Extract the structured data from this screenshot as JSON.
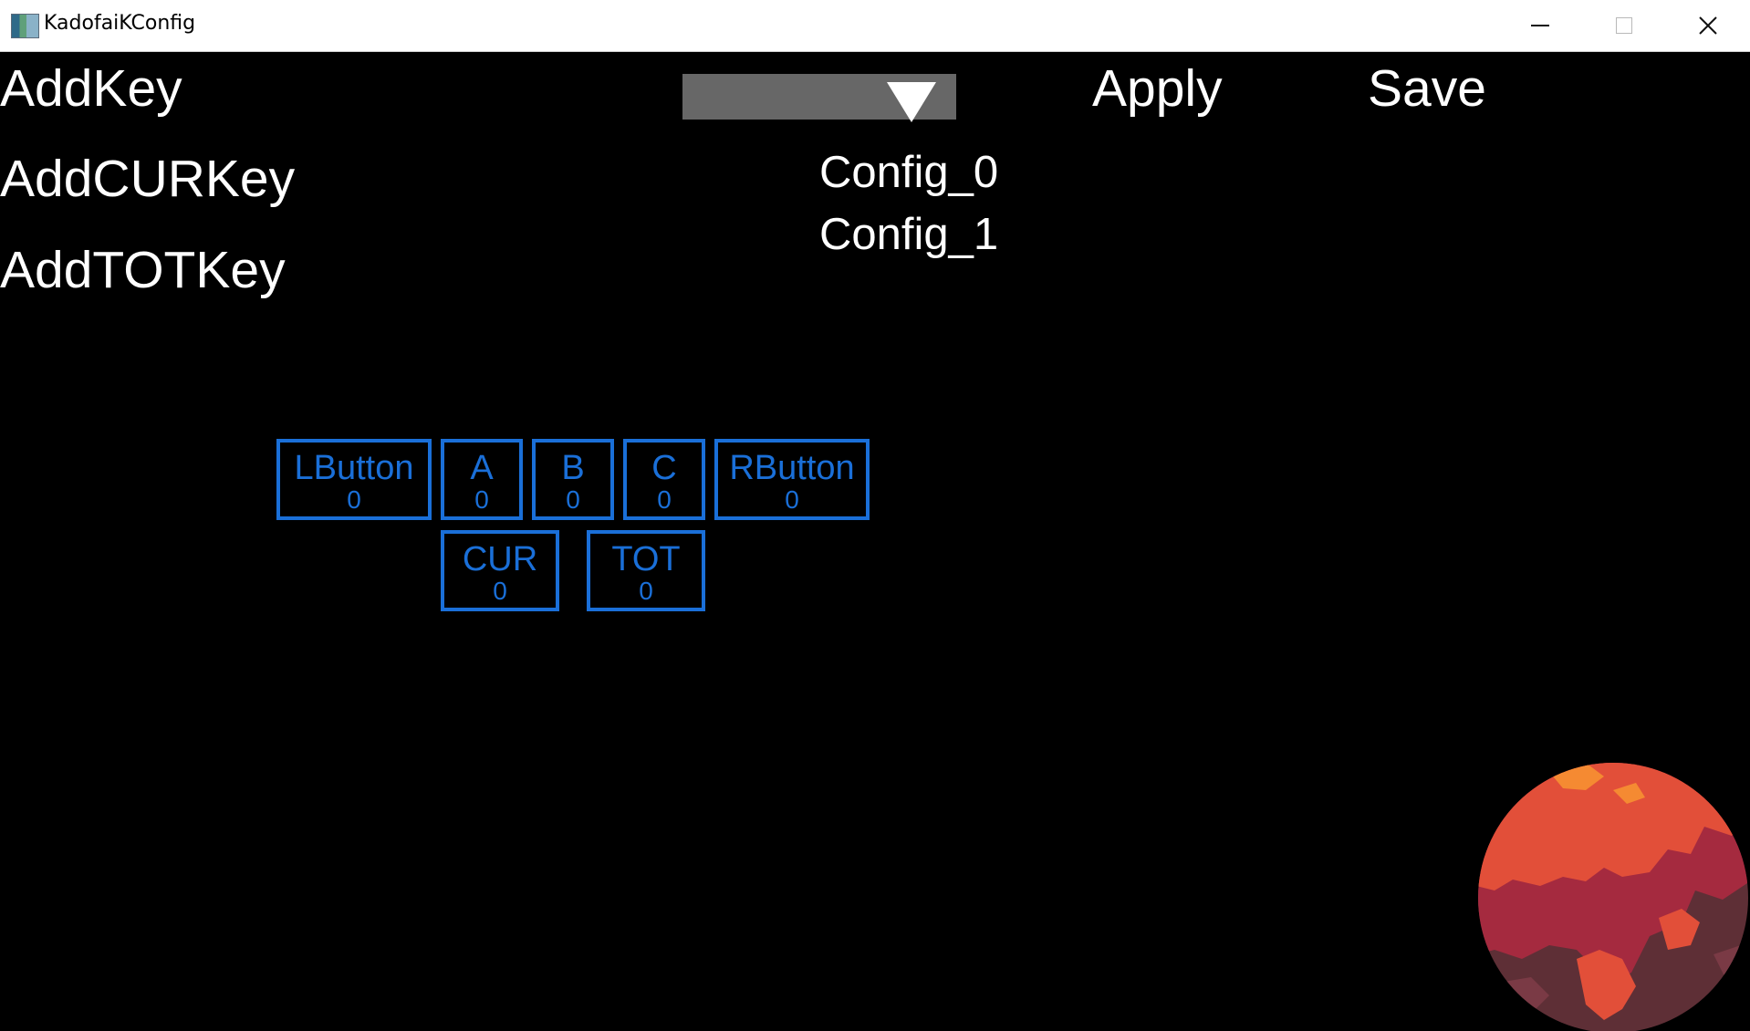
{
  "window": {
    "title": "KadofaiKConfig",
    "icons": {
      "app": "app-icon",
      "minimize": "minimize-icon",
      "maximize": "maximize-icon",
      "close": "close-icon"
    }
  },
  "commands": {
    "add_key": "AddKey",
    "add_cur_key": "AddCURKey",
    "add_tot_key": "AddTOTKey",
    "apply": "Apply",
    "save": "Save"
  },
  "config_dropdown": {
    "selected": "",
    "icon": "triangle-down-icon",
    "options": [
      "Config_0",
      "Config_1"
    ]
  },
  "keys": {
    "row1": [
      {
        "name": "LButton",
        "count": "0"
      },
      {
        "name": "A",
        "count": "0"
      },
      {
        "name": "B",
        "count": "0"
      },
      {
        "name": "C",
        "count": "0"
      },
      {
        "name": "RButton",
        "count": "0"
      }
    ],
    "row2": [
      {
        "name": "CUR",
        "count": "0"
      },
      {
        "name": "TOT",
        "count": "0"
      }
    ]
  },
  "colors": {
    "background": "#000000",
    "text": "#ffffff",
    "key_accent": "#1a6fd8",
    "dropdown": "#676767",
    "planet_light": "#e24f39",
    "planet_dark": "#a52a3f",
    "planet_shadow": "#5e2f36",
    "planet_highlight": "#f58a32"
  }
}
